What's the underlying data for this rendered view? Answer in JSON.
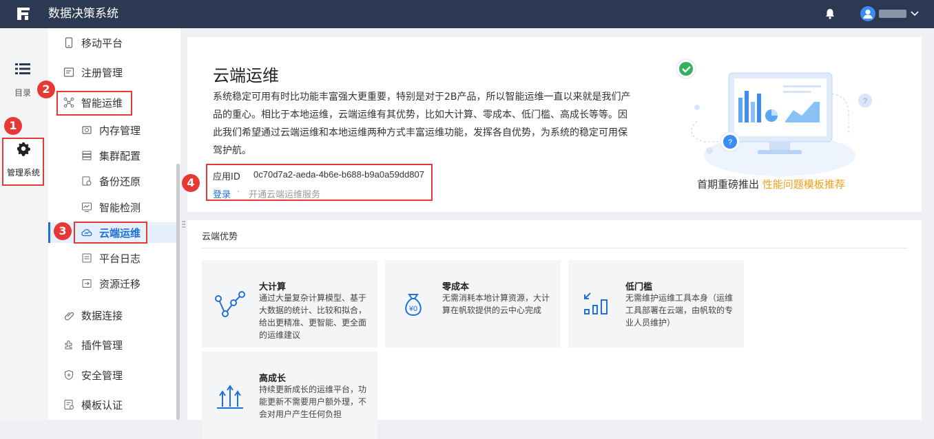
{
  "app": {
    "title": "数据决策系统"
  },
  "rail": {
    "directory_label": "目录",
    "manage_label": "管理系统"
  },
  "menu": {
    "items": [
      {
        "label": "移动平台",
        "icon": "mobile-icon"
      },
      {
        "label": "注册管理",
        "icon": "register-icon"
      },
      {
        "label": "智能运维",
        "icon": "ops-network-icon"
      },
      {
        "label": "内存管理",
        "icon": "memory-icon"
      },
      {
        "label": "集群配置",
        "icon": "cluster-icon"
      },
      {
        "label": "备份还原",
        "icon": "backup-icon"
      },
      {
        "label": "智能检测",
        "icon": "monitor-icon"
      },
      {
        "label": "云端运维",
        "icon": "cloud-ops-icon"
      },
      {
        "label": "平台日志",
        "icon": "log-icon"
      },
      {
        "label": "资源迁移",
        "icon": "migrate-icon"
      },
      {
        "label": "数据连接",
        "icon": "link-icon"
      },
      {
        "label": "插件管理",
        "icon": "plugin-icon"
      },
      {
        "label": "安全管理",
        "icon": "security-icon"
      },
      {
        "label": "模板认证",
        "icon": "template-icon"
      }
    ]
  },
  "content": {
    "title": "云端运维",
    "description": "系统稳定可用有时比功能丰富强大更重要，特别是对于2B产品，所以智能运维一直以来就是我们产品的重心。相比于本地运维，云端运维有其优势，比如大计算、零成本、低门槛、高成长等等。因此我们希望通过云端运维和本地运维两种方式丰富运维功能，发挥各自优势，为系统的稳定可用保驾护航。",
    "app_id_label": "应用ID",
    "app_id_value": "0c70d7a2-aeda-4b6e-b688-b9a0a59dd807",
    "login_label": "登录",
    "separator": "·",
    "open_service_label": "开通云端运维服务",
    "promo_prefix": "首期重磅推出",
    "promo_highlight": "性能问题模板推荐"
  },
  "advantages": {
    "title": "云端优势",
    "cards": [
      {
        "title": "大计算",
        "desc": "通过大量复杂计算模型、基于大数据的统计、比较和拟合，给出更精准、更智能、更全面的运维建议",
        "icon": "graph-nodes-icon"
      },
      {
        "title": "零成本",
        "desc": "无需消耗本地计算资源，大计算在帆软提供的云中心完成",
        "icon": "money-bag-icon"
      },
      {
        "title": "低门槛",
        "desc": "无需维护运维工具本身（运维工具部署在云端，由帆软的专业人员维护）",
        "icon": "steps-icon"
      },
      {
        "title": "高成长",
        "desc": "持续更新成长的运维平台，功能更新不需要用户额外理，不会对用户产生任何负担",
        "icon": "growth-arrows-icon"
      }
    ]
  },
  "annotations": [
    "1",
    "2",
    "3",
    "4"
  ],
  "colors": {
    "topbar": "#2b3a52",
    "accent": "#1e6fd9",
    "highlight": "#f0a018",
    "annotation": "#e53935"
  }
}
